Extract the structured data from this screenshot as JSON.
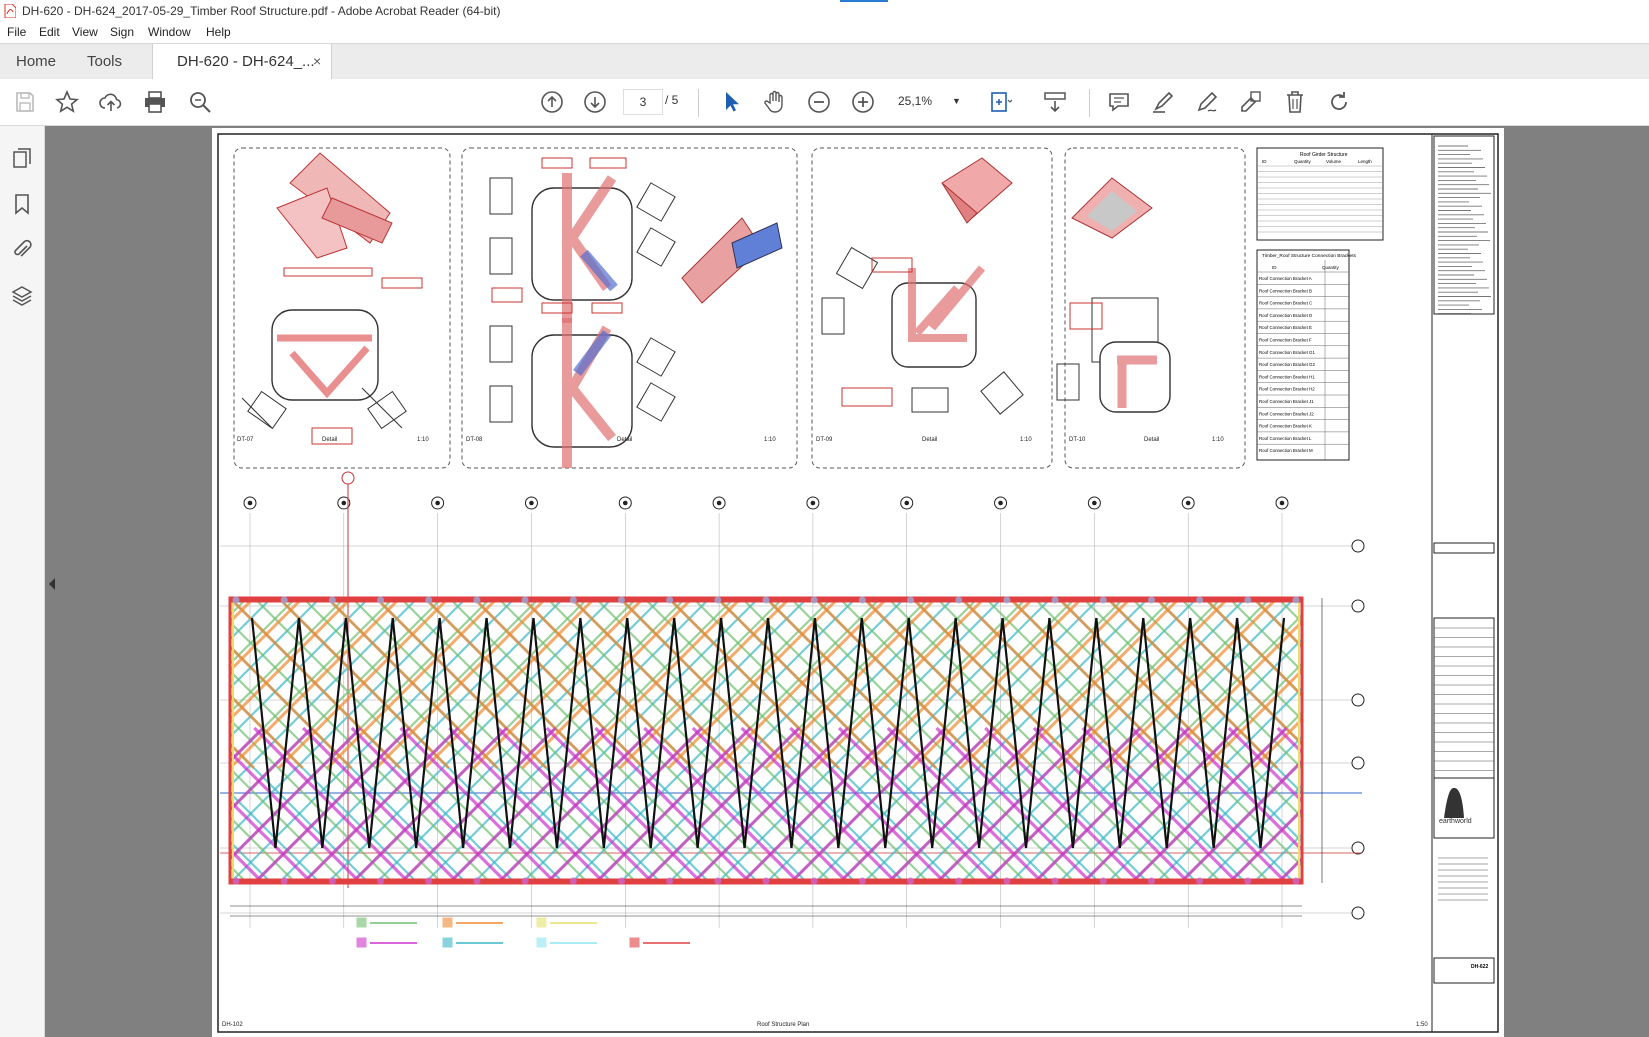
{
  "window": {
    "title": "DH-620 - DH-624_2017-05-29_Timber Roof Structure.pdf - Adobe Acrobat Reader (64-bit)"
  },
  "menu": [
    "File",
    "Edit",
    "View",
    "Sign",
    "Window",
    "Help"
  ],
  "tabs": {
    "home": "Home",
    "tools": "Tools",
    "document": "DH-620 - DH-624_...",
    "close": "×"
  },
  "toolbar": {
    "current_page": "3",
    "total_pages": "/ 5",
    "zoom": "25,1%"
  },
  "drawing": {
    "details": [
      {
        "id": "DT-07",
        "label": "Detail",
        "scale": "1:10"
      },
      {
        "id": "DT-08",
        "label": "Detail",
        "scale": "1:10"
      },
      {
        "id": "DT-09",
        "label": "Detail",
        "scale": "1:10"
      },
      {
        "id": "DT-10",
        "label": "Detail",
        "scale": "1:10"
      }
    ],
    "plan_id": "DH-102",
    "plan_title": "Roof Structure Plan",
    "plan_scale": "1:50",
    "table1_title": "Roof Girder Structure",
    "table1_headers": [
      "ID",
      "Quantity",
      "Volume",
      "Length"
    ],
    "table2_title": "Timber_Roof Structure Connection Brackets",
    "table2_headers": [
      "ID",
      "Quantity"
    ],
    "brackets": [
      "Roof Connection Bracket A",
      "Roof Connection Bracket B",
      "Roof Connection Bracket C",
      "Roof Connection Bracket D",
      "Roof Connection Bracket E",
      "Roof Connection Bracket F",
      "Roof Connection Bracket G1",
      "Roof Connection Bracket G2",
      "Roof Connection Bracket H1",
      "Roof Connection Bracket H2",
      "Roof Connection Bracket J1",
      "Roof Connection Bracket J2",
      "Roof Connection Bracket K",
      "Roof Connection Bracket L",
      "Roof Connection Bracket M"
    ],
    "logo_text": "earthworld",
    "sheet_no": "DH-622",
    "legend_colors": [
      "#6fbf6f",
      "#f08a30",
      "#e6e06a",
      "#cc33cc",
      "#3ab7c7",
      "#8ee6f0",
      "#e04040"
    ]
  }
}
